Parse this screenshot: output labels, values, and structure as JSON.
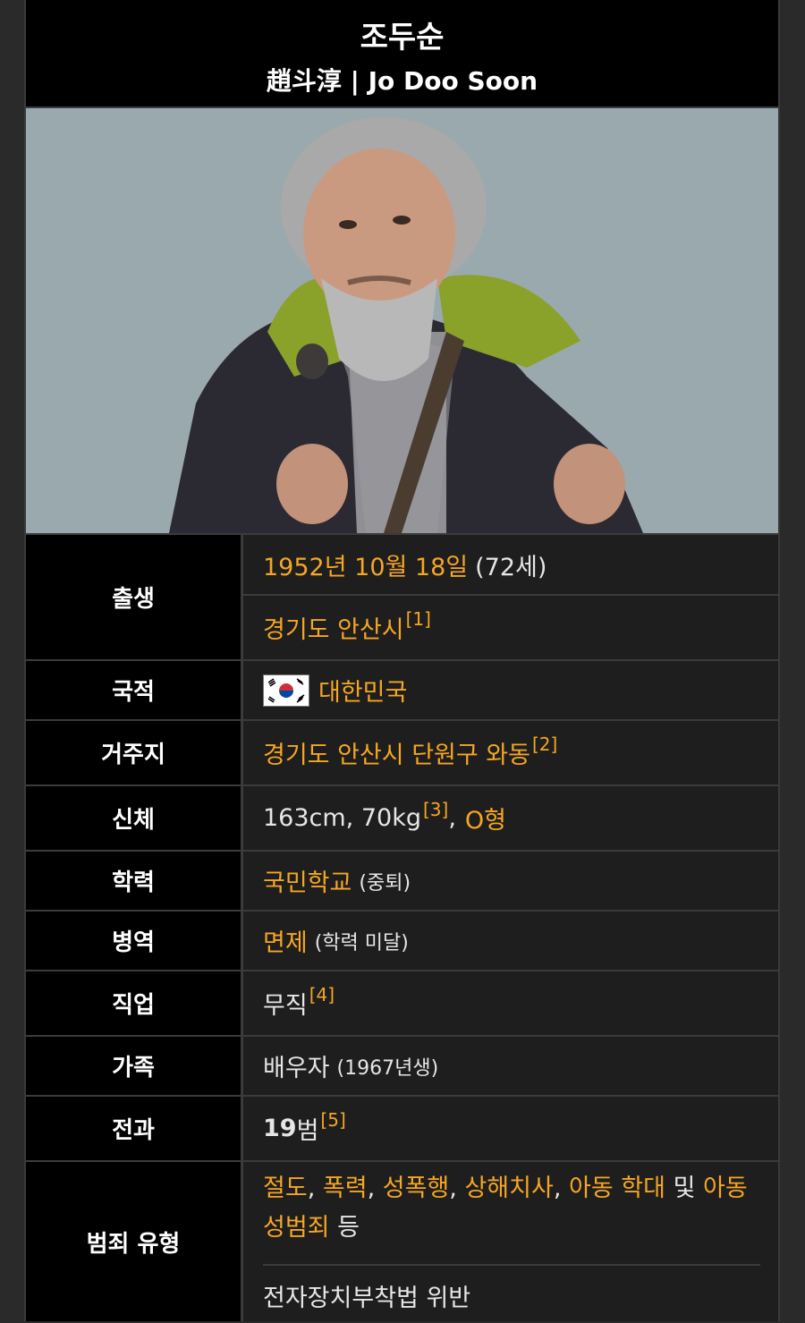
{
  "header": {
    "name": "조두순",
    "subtitle": "趙斗淳 | Jo Doo Soon"
  },
  "colors": {
    "link": "#f5a623",
    "label_bg": "#000000",
    "row_bg": "#1e1e1e"
  },
  "rows": {
    "birth": {
      "label": "출생",
      "date": "1952년 10월 18일",
      "age": "(72세)",
      "place": "경기도 안산시",
      "place_ref": "[1]"
    },
    "nationality": {
      "label": "국적",
      "value": "대한민국",
      "icon": "south-korea-flag-icon"
    },
    "residence": {
      "label": "거주지",
      "value": "경기도 안산시 단원구 와동",
      "ref": "[2]"
    },
    "body": {
      "label": "신체",
      "value": "163cm, 70kg",
      "ref": "[3]",
      "sep": ",",
      "blood": "O형"
    },
    "education": {
      "label": "학력",
      "value": "국민학교",
      "note": "(중퇴)"
    },
    "military": {
      "label": "병역",
      "value": "면제",
      "note": "(학력 미달)"
    },
    "job": {
      "label": "직업",
      "value": "무직",
      "ref": "[4]"
    },
    "family": {
      "label": "가족",
      "value": "배우자",
      "note": "(1967년생)"
    },
    "record": {
      "label": "전과",
      "num": "19",
      "unit": "범",
      "ref": "[5]"
    },
    "crimes": {
      "label": "범죄 유형",
      "items": [
        "절도",
        "폭력",
        "성폭행",
        "상해치사",
        "아동 학대",
        "아동 성범죄"
      ],
      "sep": ",",
      "and": "및",
      "etc": "등",
      "extra": "전자장치부착법 위반"
    }
  }
}
